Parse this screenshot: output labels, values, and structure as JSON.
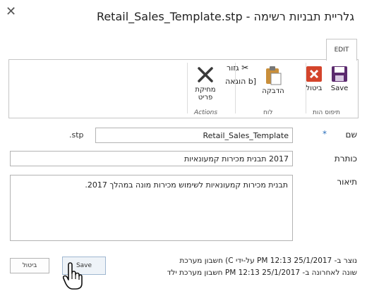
{
  "dialog": {
    "title": "גלריית תבניות רשימה - Retail_Sales_Template.stp",
    "close_glyph": "✕"
  },
  "ribbon": {
    "tab_label": "EDIT",
    "commit_group": {
      "label": "תיפוס הות",
      "save_label": "Save",
      "cancel_label": "ביטול",
      "save_color": "#5b2a6e",
      "cancel_color": "#d4442b"
    },
    "clipboard_group": {
      "label": "לוח",
      "paste_label": "הדבקה",
      "cut_label": "גזור",
      "copy_label": "[b הוגאה"
    },
    "actions_group": {
      "label": "Actions",
      "delete_label_line1": "מחיקת",
      "delete_label_line2": "פריט"
    }
  },
  "form": {
    "name": {
      "label": "שם",
      "required_mark": "*",
      "value": "Retail_Sales_Template",
      "suffix": ".stp"
    },
    "title": {
      "label": "כותרת",
      "value": "2017 תבנית מכירות קמעונאיות"
    },
    "description": {
      "label": "תיאור",
      "value": "תבנית מכירות קמעונאיות לשימוש מכירות מונה במהלך 2017."
    }
  },
  "footer": {
    "created_line": "נוצר ב- 25/1/2017 PM 12:13 על-ידי C) חשבון מערכת",
    "modified_line": "שונה לאחרונה ב- 25/1/2017 PM 12:13 חשבון מערכת ילד",
    "save_label": "Save",
    "cancel_label": "ביטול"
  }
}
